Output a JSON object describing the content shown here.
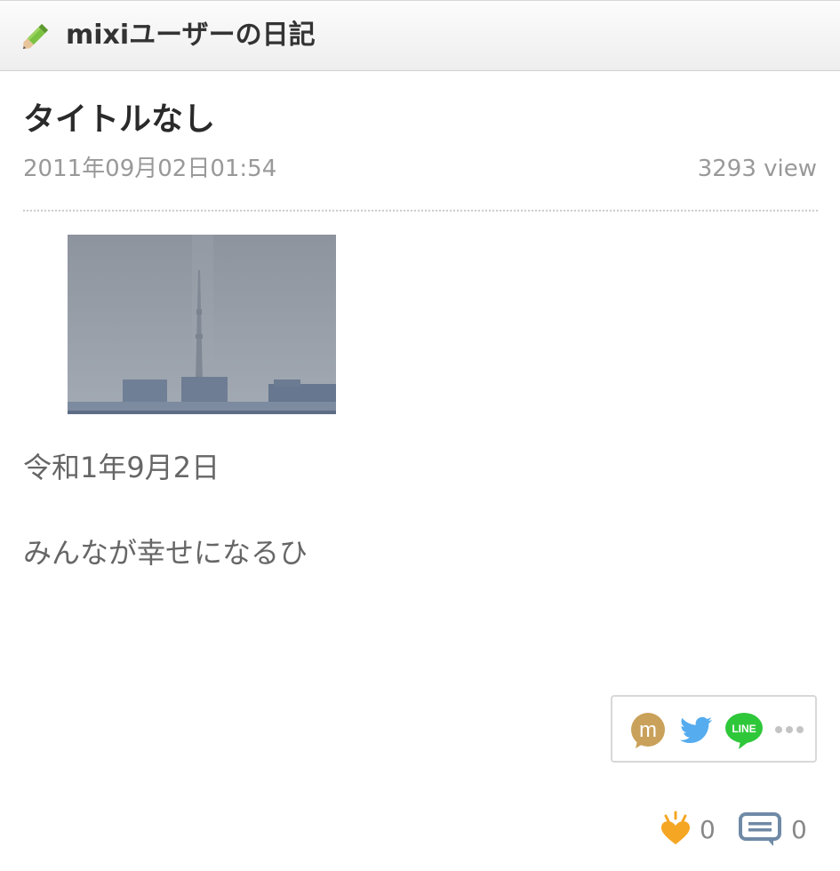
{
  "header": {
    "title": "mixiユーザーの日記",
    "icon": "pencil-icon"
  },
  "entry": {
    "title": "タイトルなし",
    "date": "2011年09月02日01:54",
    "views": "3293 view",
    "body_lines": [
      "令和1年9月2日",
      "みんなが幸せになるひ"
    ]
  },
  "share": {
    "buttons": [
      "mixi-share-icon",
      "twitter-icon",
      "line-icon",
      "more-icon"
    ],
    "line_text": "LINE",
    "mixi_letter": "m"
  },
  "reactions": {
    "iine_count": "0",
    "comment_count": "0"
  },
  "colors": {
    "mixi_gold": "#c9a15a",
    "twitter_blue": "#55acee",
    "line_green": "#2fc73a",
    "iine_orange": "#f5a623",
    "comment_blue": "#6f8aa6"
  }
}
